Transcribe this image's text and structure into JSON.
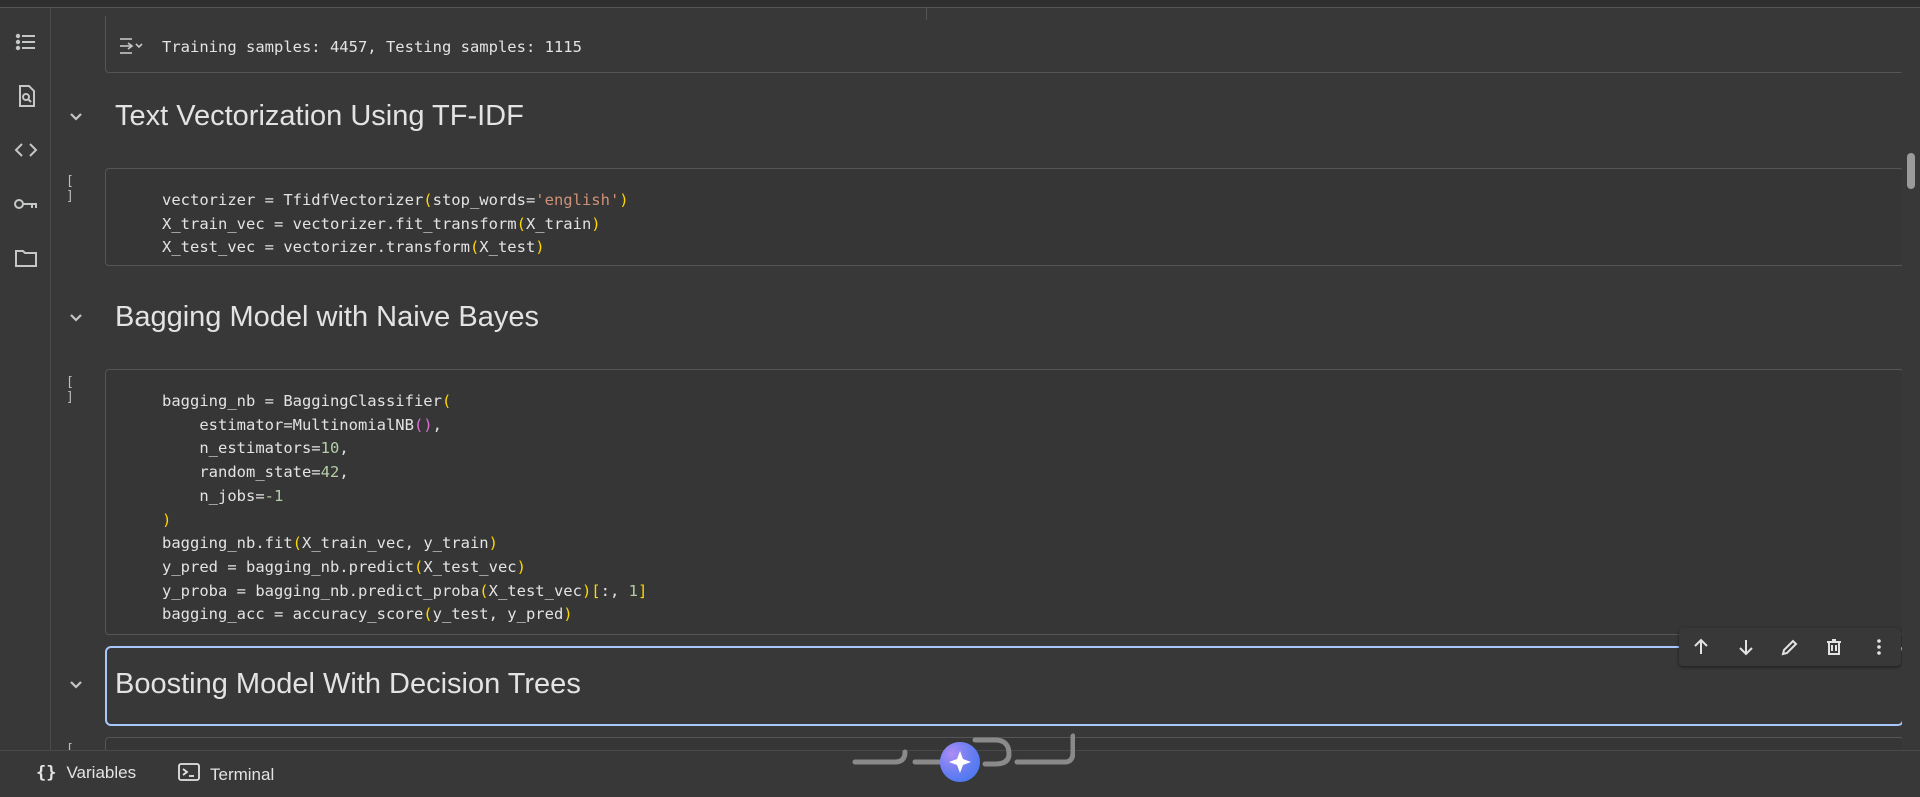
{
  "sidebar": {
    "items": [
      {
        "icon": "table-of-contents-icon"
      },
      {
        "icon": "find-replace-icon"
      },
      {
        "icon": "code-snippets-icon"
      },
      {
        "icon": "secrets-key-icon"
      },
      {
        "icon": "files-folder-icon"
      }
    ]
  },
  "cells": {
    "output_prev": {
      "text": "Training samples: 4457, Testing samples: 1115"
    },
    "heading_tfidf": {
      "title": "Text Vectorization Using TF-IDF"
    },
    "code_tfidf": {
      "exec_count": "[ ]",
      "lines": [
        "vectorizer = TfidfVectorizer(stop_words='english')",
        "X_train_vec = vectorizer.fit_transform(X_train)",
        "X_test_vec = vectorizer.transform(X_test)"
      ]
    },
    "heading_bagging": {
      "title": "Bagging Model with Naive Bayes"
    },
    "code_bagging": {
      "exec_count": "[ ]",
      "lines": [
        "bagging_nb = BaggingClassifier(",
        "    estimator=MultinomialNB(),",
        "    n_estimators=10,",
        "    random_state=42,",
        "    n_jobs=-1",
        ")",
        "bagging_nb.fit(X_train_vec, y_train)",
        "y_pred = bagging_nb.predict(X_test_vec)",
        "y_proba = bagging_nb.predict_proba(X_test_vec)[:, 1]",
        "bagging_acc = accuracy_score(y_test, y_pred)"
      ]
    },
    "heading_boosting": {
      "title": "Boosting Model With Decision Trees"
    },
    "code_next": {
      "exec_count": "[ ]"
    }
  },
  "cell_toolbar": {
    "buttons": [
      "move-up-icon",
      "move-down-icon",
      "edit-pencil-icon",
      "delete-trash-icon",
      "more-vert-icon"
    ]
  },
  "bottombar": {
    "variables_label": "Variables",
    "terminal_label": "Terminal"
  },
  "colors": {
    "background": "#383838",
    "selected_border": "#a8c7fa",
    "bracket_yellow": "#ffd700",
    "bracket_purple": "#da70d6",
    "string": "#ce9178",
    "number": "#b5cea8"
  }
}
